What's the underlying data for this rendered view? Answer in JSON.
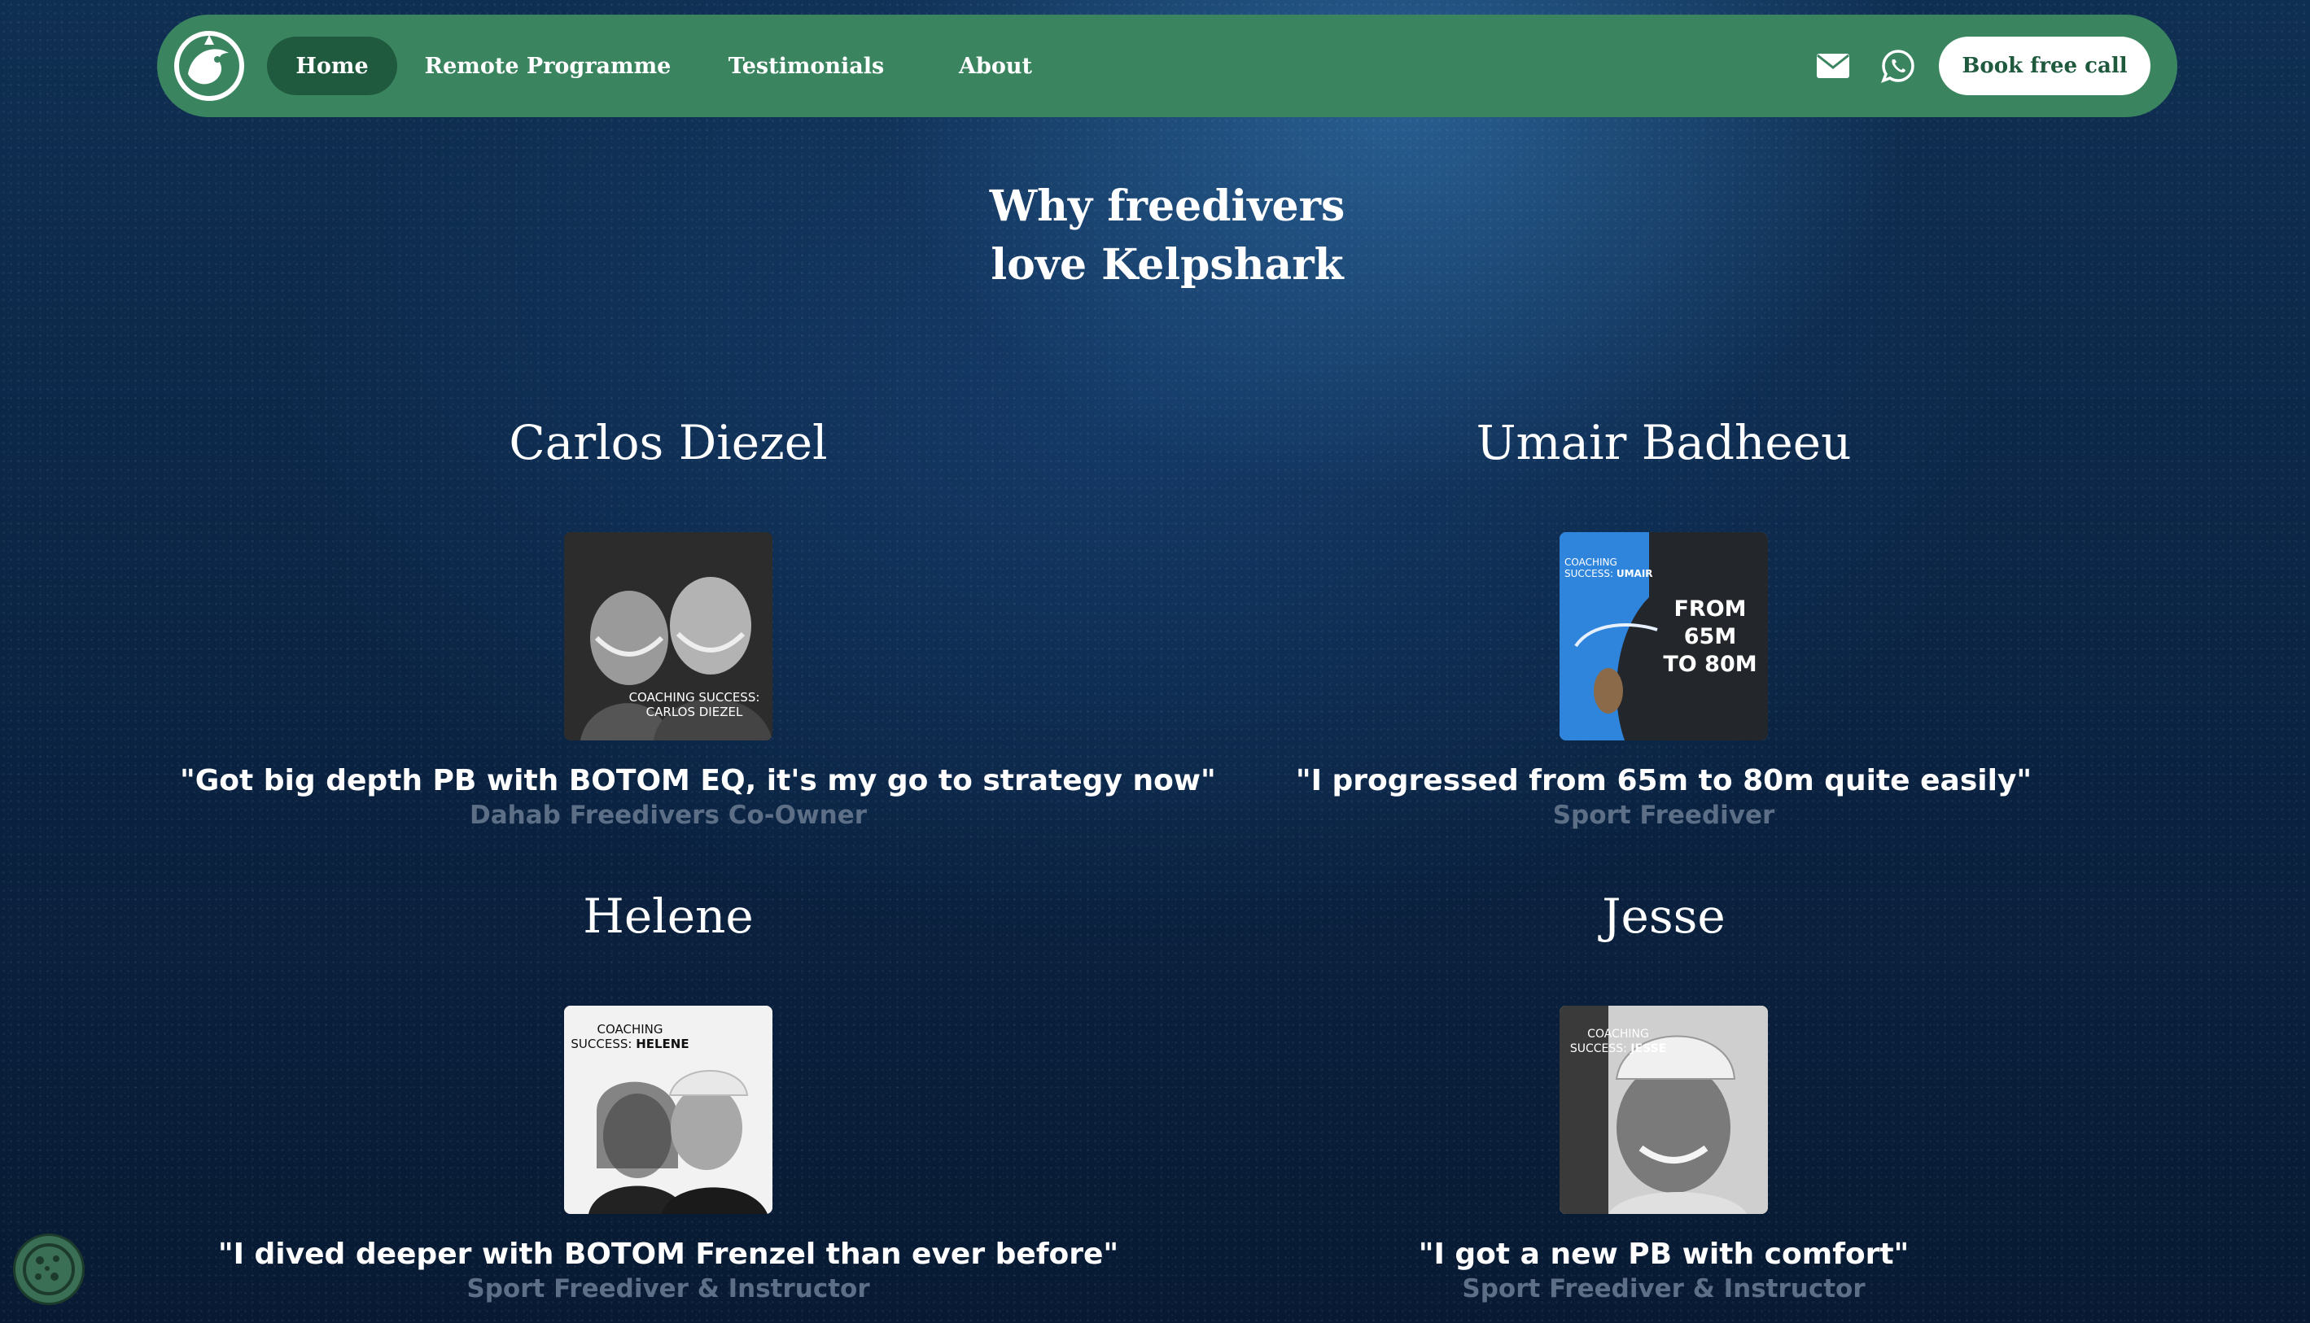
{
  "nav": {
    "logo_icon": "kelpshark-logo-icon",
    "links": [
      {
        "label": "Home",
        "active": true
      },
      {
        "label": "Remote Programme",
        "active": false
      },
      {
        "label": "Testimonials",
        "active": false
      },
      {
        "label": "About",
        "active": false
      }
    ],
    "mail_icon": "mail-icon",
    "whatsapp_icon": "whatsapp-icon",
    "cta_label": "Book free call"
  },
  "section": {
    "title_line1": "Why freedivers",
    "title_line2": "love Kelpshark"
  },
  "testimonials": [
    {
      "name": "Carlos Diezel",
      "photo_caption_line1": "COACHING SUCCESS:",
      "photo_caption_line2": "CARLOS DIEZEL",
      "quote": "\"Got big depth PB with BOTOM EQ, it's my go to strategy now\"",
      "role": "Dahab Freedivers Co-Owner"
    },
    {
      "name": "Umair Badheeu",
      "photo_caption_line1": "COACHING",
      "photo_caption_line2": "SUCCESS: UMAIR",
      "photo_overlay_line1": "FROM 65M",
      "photo_overlay_line2": "TO 80M",
      "quote": "\"I progressed from 65m to 80m quite easily\"",
      "role": "Sport Freediver"
    },
    {
      "name": "Helene",
      "photo_caption_line1": "COACHING",
      "photo_caption_line2": "SUCCESS: HELENE",
      "quote": "\"I dived deeper with BOTOM Frenzel than ever before\"",
      "role": "Sport Freediver & Instructor"
    },
    {
      "name": "Jesse",
      "photo_caption_line1": "COACHING",
      "photo_caption_line2": "SUCCESS: JESSE",
      "quote": "\"I got a new PB with comfort\"",
      "role": "Sport Freediver & Instructor"
    }
  ],
  "cookie_icon": "cookie-icon",
  "colors": {
    "nav_green": "#3a8560",
    "nav_active": "#1f5a3e",
    "role_gray": "#5c6f86",
    "background_navy": "#0b2545"
  }
}
